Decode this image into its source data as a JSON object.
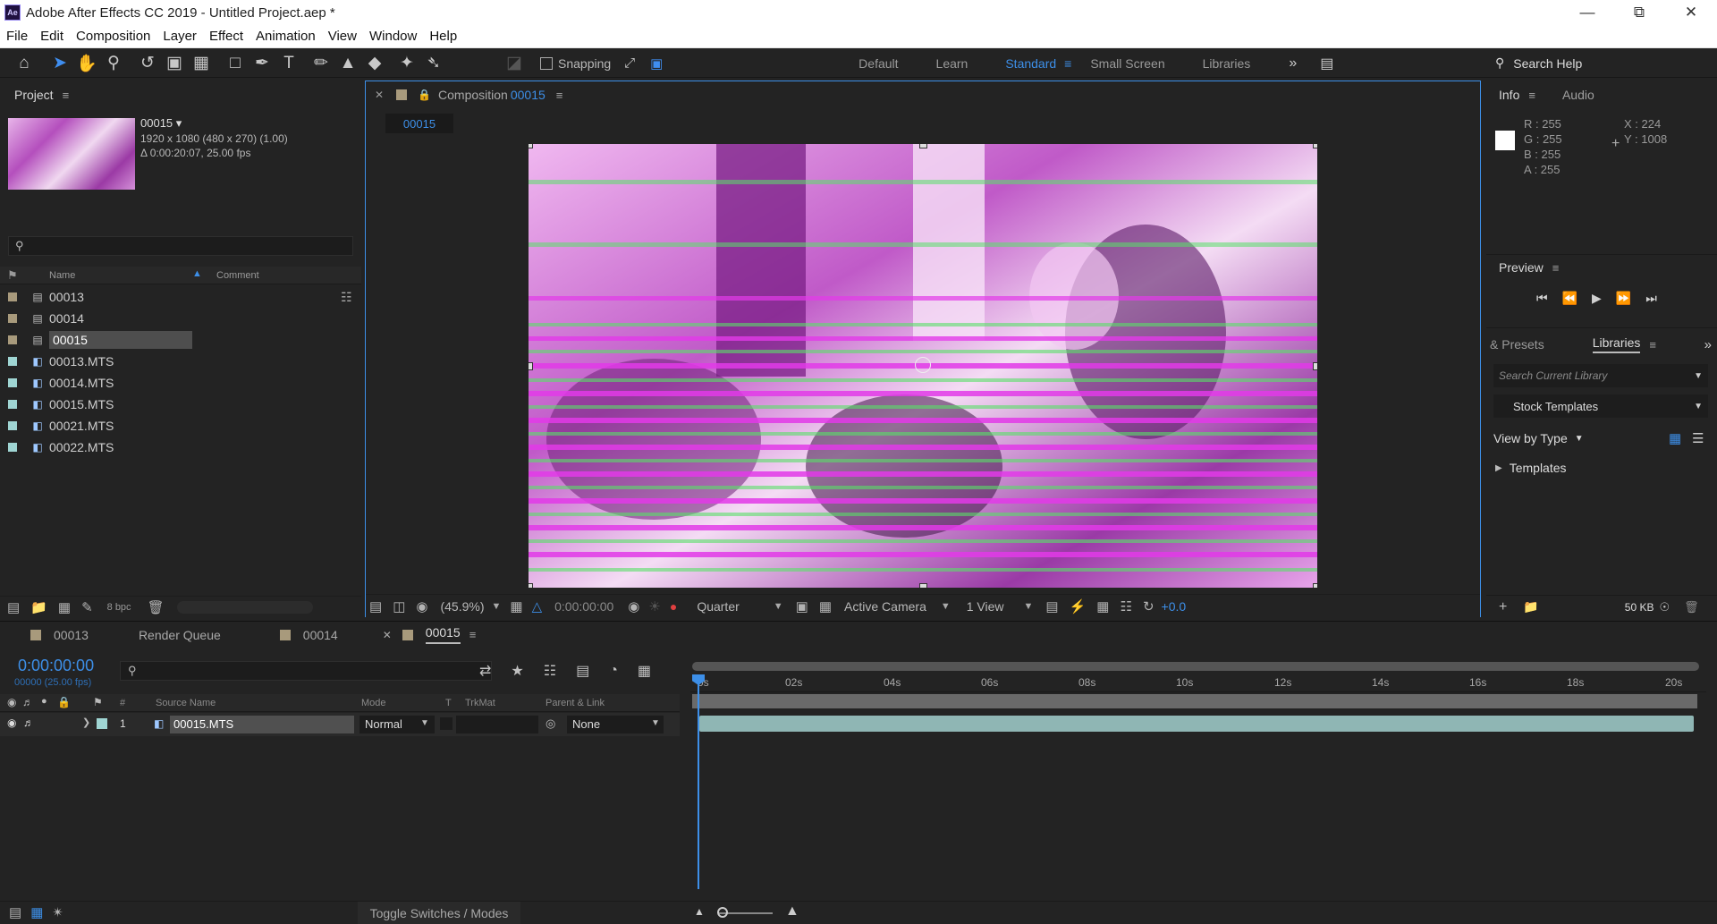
{
  "window": {
    "title": "Adobe After Effects CC 2019 - Untitled Project.aep *",
    "app_icon": "Ae"
  },
  "menu": [
    "File",
    "Edit",
    "Composition",
    "Layer",
    "Effect",
    "Animation",
    "View",
    "Window",
    "Help"
  ],
  "toolbar": {
    "snapping_label": "Snapping",
    "workspaces": [
      "Default",
      "Learn",
      "Standard",
      "Small Screen",
      "Libraries"
    ],
    "active_workspace": "Standard",
    "search_placeholder": "Search Help"
  },
  "project": {
    "title": "Project",
    "selected_name": "00015 ▾",
    "selected_info1": "1920 x 1080  (480 x 270) (1.00)",
    "selected_info2": "Δ 0:00:20:07, 25.00 fps",
    "search_placeholder": "",
    "col_name": "Name",
    "col_comment": "Comment",
    "items": [
      {
        "name": "00013",
        "type": "comp",
        "color": "#a89a7c"
      },
      {
        "name": "00014",
        "type": "comp",
        "color": "#a89a7c"
      },
      {
        "name": "00015",
        "type": "comp",
        "color": "#a89a7c",
        "selected": true
      },
      {
        "name": "00013.MTS",
        "type": "footage",
        "color": "#9fd5d3"
      },
      {
        "name": "00014.MTS",
        "type": "footage",
        "color": "#9fd5d3"
      },
      {
        "name": "00015.MTS",
        "type": "footage",
        "color": "#9fd5d3"
      },
      {
        "name": "00021.MTS",
        "type": "footage",
        "color": "#9fd5d3"
      },
      {
        "name": "00022.MTS",
        "type": "footage",
        "color": "#9fd5d3"
      }
    ],
    "bpc": "8 bpc"
  },
  "composition": {
    "panel_label": "Composition",
    "comp_name": "00015",
    "tab": "00015",
    "zoom": "(45.9%)",
    "time": "0:00:00:00",
    "resolution": "Quarter",
    "camera": "Active Camera",
    "views": "1 View",
    "exposure": "+0.0"
  },
  "info": {
    "tab_info": "Info",
    "tab_audio": "Audio",
    "r": "R : 255",
    "g": "G : 255",
    "b": "B : 255",
    "a": "A : 255",
    "x": "X : 224",
    "y": "Y : 1008"
  },
  "preview": {
    "title": "Preview"
  },
  "libraries": {
    "tab_presets": "& Presets",
    "tab_libraries": "Libraries",
    "search_placeholder": "Search Current Library",
    "library": "Stock Templates",
    "view_by": "View by Type",
    "section": "Templates",
    "size": "50 KB"
  },
  "timeline_tabs": [
    "00013",
    "Render Queue",
    "00014",
    "00015"
  ],
  "timeline": {
    "timecode": "0:00:00:00",
    "frames": "00000 (25.00 fps)",
    "col_num": "#",
    "col_source": "Source Name",
    "col_mode": "Mode",
    "col_t": "T",
    "col_trkmat": "TrkMat",
    "col_parent": "Parent & Link",
    "layer": {
      "num": "1",
      "name": "00015.MTS",
      "mode": "Normal",
      "parent": "None"
    },
    "ruler": [
      "0s",
      "02s",
      "04s",
      "06s",
      "08s",
      "10s",
      "12s",
      "14s",
      "16s",
      "18s",
      "20s"
    ],
    "toggle_label": "Toggle Switches / Modes"
  }
}
